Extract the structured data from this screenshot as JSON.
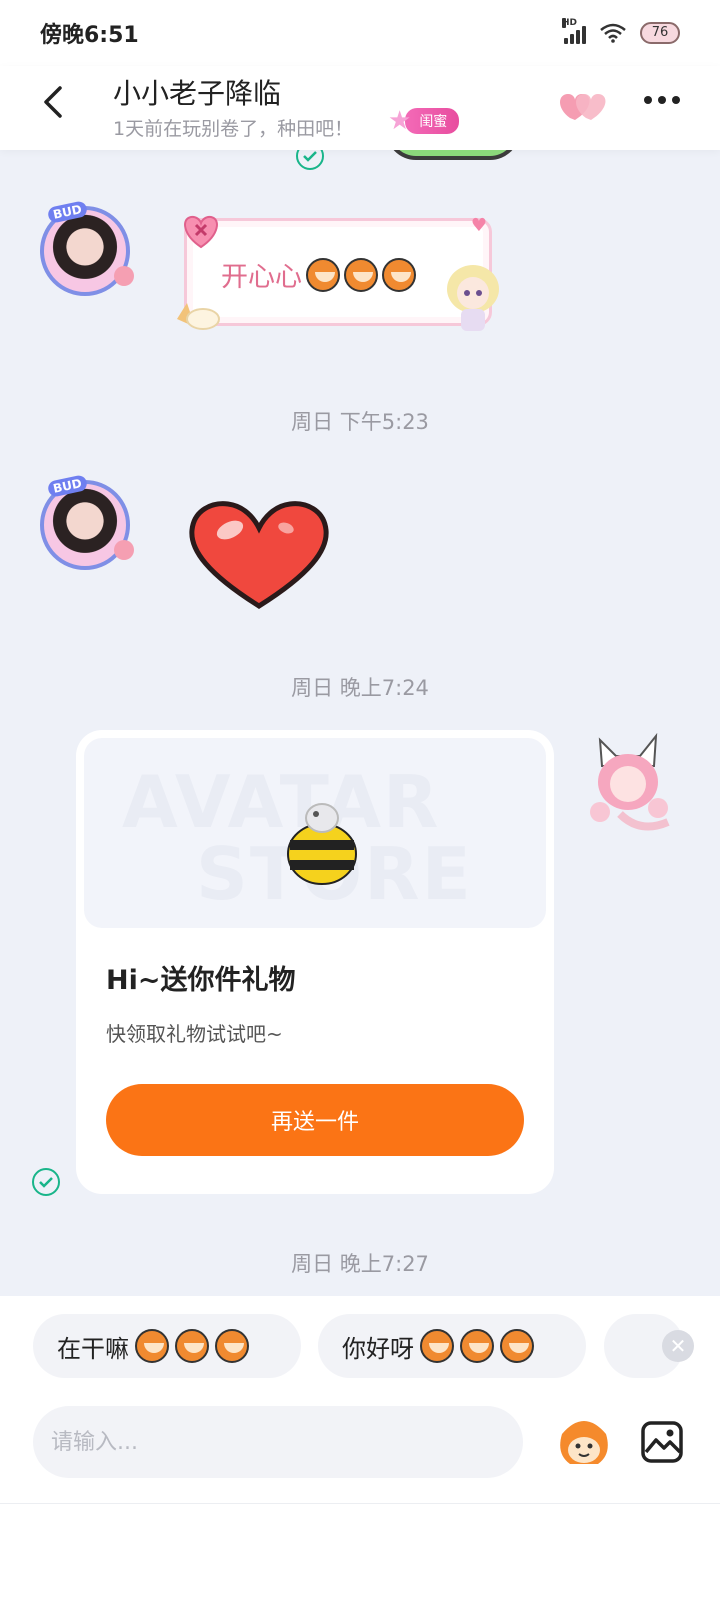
{
  "status_bar": {
    "time": "傍晚6:51",
    "network": "HD",
    "battery": "76"
  },
  "header": {
    "title": "小小老子降临",
    "subtitle": "1天前在玩别卷了，种田吧！",
    "relationship_tag": "闺蜜"
  },
  "messages": {
    "text_message": "开心心",
    "timestamp_1": "周日 下午5:23",
    "timestamp_2": "周日 晚上7:24",
    "timestamp_3": "周日 晚上7:27"
  },
  "gift_card": {
    "watermark_top": "AVATAR",
    "watermark_bottom": "STORE",
    "title": "Hi~送你件礼物",
    "description": "快领取礼物试试吧~",
    "button_label": "再送一件"
  },
  "quick_replies": [
    {
      "label": "在干嘛"
    },
    {
      "label": "你好呀"
    }
  ],
  "composer": {
    "placeholder": "请输入..."
  },
  "colors": {
    "accent_orange": "#fb7415",
    "tag_pink": "#e84d9f",
    "read_check_green": "#19b58a",
    "chat_background": "#eef1f8"
  },
  "icons": [
    "back-arrow-icon",
    "hearts-icon",
    "more-icon",
    "read-check-icon",
    "close-icon",
    "emoji-icon",
    "image-icon"
  ]
}
